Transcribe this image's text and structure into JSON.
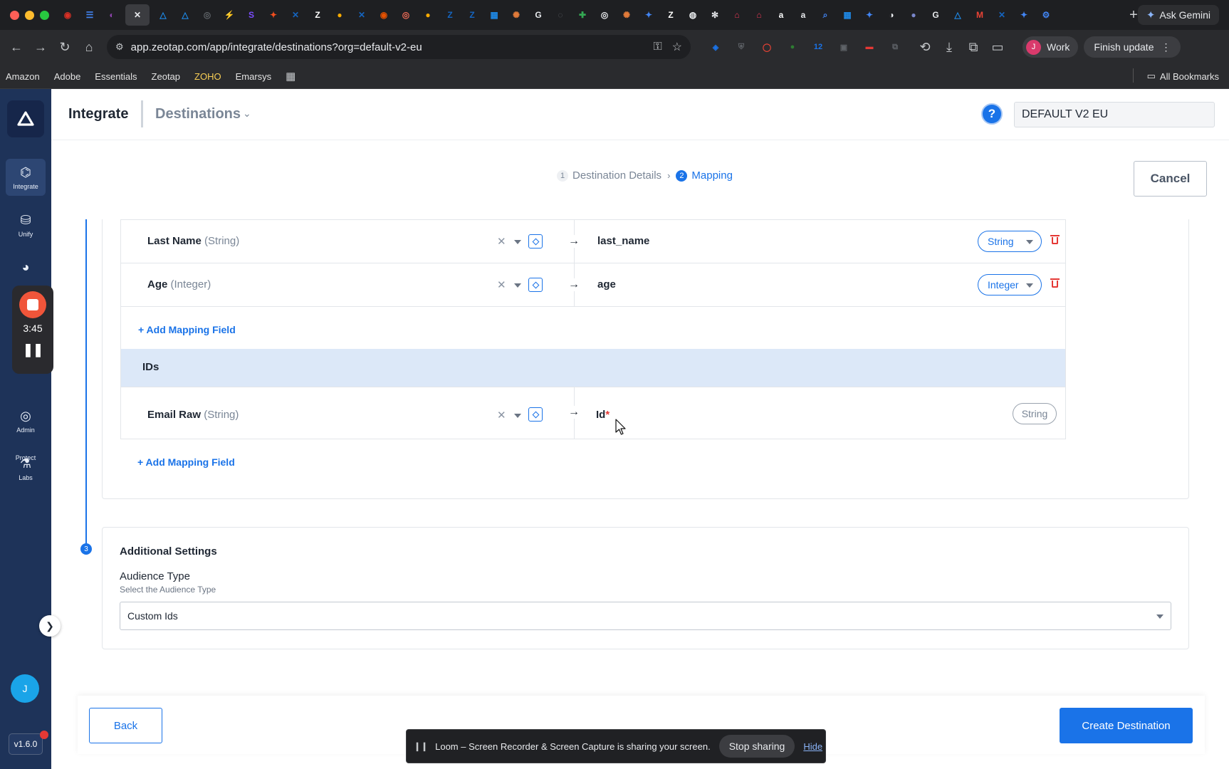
{
  "browser": {
    "tab_icons": [
      {
        "name": "tab-icon-1",
        "color": "#d93025",
        "glyph": "◉"
      },
      {
        "name": "tab-icon-2",
        "color": "#4285f4",
        "glyph": "☰"
      },
      {
        "name": "tab-icon-3",
        "color": "#8e44ad",
        "glyph": "◐"
      },
      {
        "name": "tab-icon-4",
        "color": "#1e88e5",
        "glyph": "△"
      },
      {
        "name": "tab-icon-5",
        "color": "#1e88e5",
        "glyph": "△"
      },
      {
        "name": "tab-icon-6",
        "color": "#5f6368",
        "glyph": "◎"
      },
      {
        "name": "tab-icon-7",
        "color": "#7c4dff",
        "glyph": "⚡"
      },
      {
        "name": "tab-icon-8",
        "color": "#7c4dff",
        "glyph": "S"
      },
      {
        "name": "tab-icon-9",
        "color": "#f24e1e",
        "glyph": "✦"
      },
      {
        "name": "tab-icon-10",
        "color": "#1565c0",
        "glyph": "✕"
      },
      {
        "name": "tab-icon-11",
        "color": "#ffffff",
        "glyph": "Z"
      },
      {
        "name": "tab-icon-12",
        "color": "#f9ab00",
        "glyph": "●"
      },
      {
        "name": "tab-icon-13",
        "color": "#1565c0",
        "glyph": "✕"
      },
      {
        "name": "tab-icon-14",
        "color": "#e65100",
        "glyph": "◉"
      },
      {
        "name": "tab-icon-15",
        "color": "#ef6c57",
        "glyph": "◎"
      },
      {
        "name": "tab-icon-16",
        "color": "#f9ab00",
        "glyph": "●"
      },
      {
        "name": "tab-icon-17",
        "color": "#1565c0",
        "glyph": "Z"
      },
      {
        "name": "tab-icon-18",
        "color": "#1565c0",
        "glyph": "Z"
      },
      {
        "name": "tab-icon-19",
        "color": "#1e88e5",
        "glyph": "▦"
      },
      {
        "name": "tab-icon-20",
        "color": "#e07a3a",
        "glyph": "✺"
      },
      {
        "name": "tab-icon-21",
        "color": "#e8eaed",
        "glyph": "G"
      },
      {
        "name": "tab-icon-22",
        "color": "#5f6368",
        "glyph": "◌"
      },
      {
        "name": "tab-icon-23",
        "color": "#34a853",
        "glyph": "✚"
      },
      {
        "name": "tab-icon-24",
        "color": "#e8eaed",
        "glyph": "◎"
      },
      {
        "name": "tab-icon-25",
        "color": "#e07a3a",
        "glyph": "✺"
      },
      {
        "name": "tab-icon-26",
        "color": "#4285f4",
        "glyph": "✦"
      },
      {
        "name": "tab-icon-27",
        "color": "#ffffff",
        "glyph": "Z"
      },
      {
        "name": "tab-icon-28",
        "color": "#e8eaed",
        "glyph": "◍"
      },
      {
        "name": "tab-icon-29",
        "color": "#e8eaed",
        "glyph": "✻"
      },
      {
        "name": "tab-icon-30",
        "color": "#e53955",
        "glyph": "⌂"
      },
      {
        "name": "tab-icon-31",
        "color": "#e53955",
        "glyph": "⌂"
      },
      {
        "name": "tab-icon-32",
        "color": "#ffffff",
        "glyph": "a"
      },
      {
        "name": "tab-icon-33",
        "color": "#e8eaed",
        "glyph": "a"
      },
      {
        "name": "tab-icon-34",
        "color": "#4285f4",
        "glyph": "⌕"
      },
      {
        "name": "tab-icon-35",
        "color": "#1e88e5",
        "glyph": "▦"
      },
      {
        "name": "tab-icon-36",
        "color": "#4285f4",
        "glyph": "✦"
      },
      {
        "name": "tab-icon-37",
        "color": "#e8eaed",
        "glyph": "◑"
      },
      {
        "name": "tab-icon-38",
        "color": "#7986cb",
        "glyph": "●"
      },
      {
        "name": "tab-icon-39",
        "color": "#e8eaed",
        "glyph": "G"
      },
      {
        "name": "tab-icon-40",
        "color": "#1e88e5",
        "glyph": "△"
      },
      {
        "name": "tab-icon-41",
        "color": "#ea4335",
        "glyph": "M"
      },
      {
        "name": "tab-icon-42",
        "color": "#1565c0",
        "glyph": "✕"
      },
      {
        "name": "tab-icon-43",
        "color": "#4285f4",
        "glyph": "✦"
      },
      {
        "name": "tab-icon-44",
        "color": "#4285f4",
        "glyph": "⚙"
      }
    ],
    "ask_gemini": "Ask Gemini",
    "url": "app.zeotap.com/app/integrate/destinations?org=default-v2-eu",
    "profile_initial": "J",
    "profile_label": "Work",
    "finish_update": "Finish update",
    "extensions": [
      {
        "name": "extension-icon-1",
        "color": "#1a73e8",
        "glyph": "◈"
      },
      {
        "name": "extension-icon-2",
        "color": "#5f6368",
        "glyph": "⛨"
      },
      {
        "name": "extension-icon-3",
        "color": "#ea4335",
        "glyph": "◯"
      },
      {
        "name": "extension-icon-4",
        "color": "#2e7d32",
        "glyph": "●"
      },
      {
        "name": "extension-icon-5",
        "color": "#1a73e8",
        "glyph": "12"
      },
      {
        "name": "extension-icon-6",
        "color": "#5f6368",
        "glyph": "▣"
      },
      {
        "name": "extension-icon-7",
        "color": "#e53935",
        "glyph": "▬"
      },
      {
        "name": "extension-icon-8",
        "color": "#5f6368",
        "glyph": "⧉"
      }
    ],
    "bookmarks": [
      "Amazon",
      "Adobe",
      "Essentials",
      "Zeotap",
      "ZOHO",
      "Emarsys"
    ],
    "all_bookmarks": "All Bookmarks"
  },
  "sidebar": {
    "items": [
      {
        "name": "sidebar-item-integrate",
        "label": "Integrate",
        "icon": "⌬",
        "active": true
      },
      {
        "name": "sidebar-item-unify",
        "label": "Unify",
        "icon": "⛁",
        "active": false
      },
      {
        "name": "sidebar-item-activate",
        "label": "",
        "icon": "◕",
        "active": false
      },
      {
        "name": "sidebar-item-protect",
        "label": "Protect",
        "icon": "",
        "active": false
      },
      {
        "name": "sidebar-item-admin",
        "label": "Admin",
        "icon": "◎",
        "active": false
      },
      {
        "name": "sidebar-item-labs",
        "label": "Labs",
        "icon": "⚗",
        "active": false
      }
    ],
    "avatar_initial": "J",
    "version": "v1.6.0"
  },
  "loom_widget": {
    "time": "3:45"
  },
  "header": {
    "title": "Integrate",
    "subtitle": "Destinations",
    "org": "DEFAULT V2 EU"
  },
  "stepper": {
    "step1_num": "1",
    "step1_label": "Destination Details",
    "step2_num": "2",
    "step2_label": "Mapping",
    "cancel": "Cancel"
  },
  "mapping": {
    "rows": [
      {
        "source": "Last Name",
        "source_type": "(String)",
        "target": "last_name",
        "type": "String"
      },
      {
        "source": "Age",
        "source_type": "(Integer)",
        "target": "age",
        "type": "Integer"
      }
    ],
    "add_field": "+ Add Mapping Field",
    "ids_section": "IDs",
    "id_row": {
      "source": "Email Raw",
      "source_type": "(String)",
      "target": "Id",
      "required_mark": "*",
      "type": "String"
    },
    "add_field_ids": "+ Add Mapping Field"
  },
  "settings": {
    "step_num": "3",
    "title": "Additional Settings",
    "audience_label": "Audience Type",
    "audience_help": "Select the Audience Type",
    "audience_value": "Custom Ids"
  },
  "footer": {
    "back": "Back",
    "create": "Create Destination"
  },
  "sharebar": {
    "message": "Loom – Screen Recorder & Screen Capture is sharing your screen.",
    "stop": "Stop sharing",
    "hide": "Hide"
  }
}
